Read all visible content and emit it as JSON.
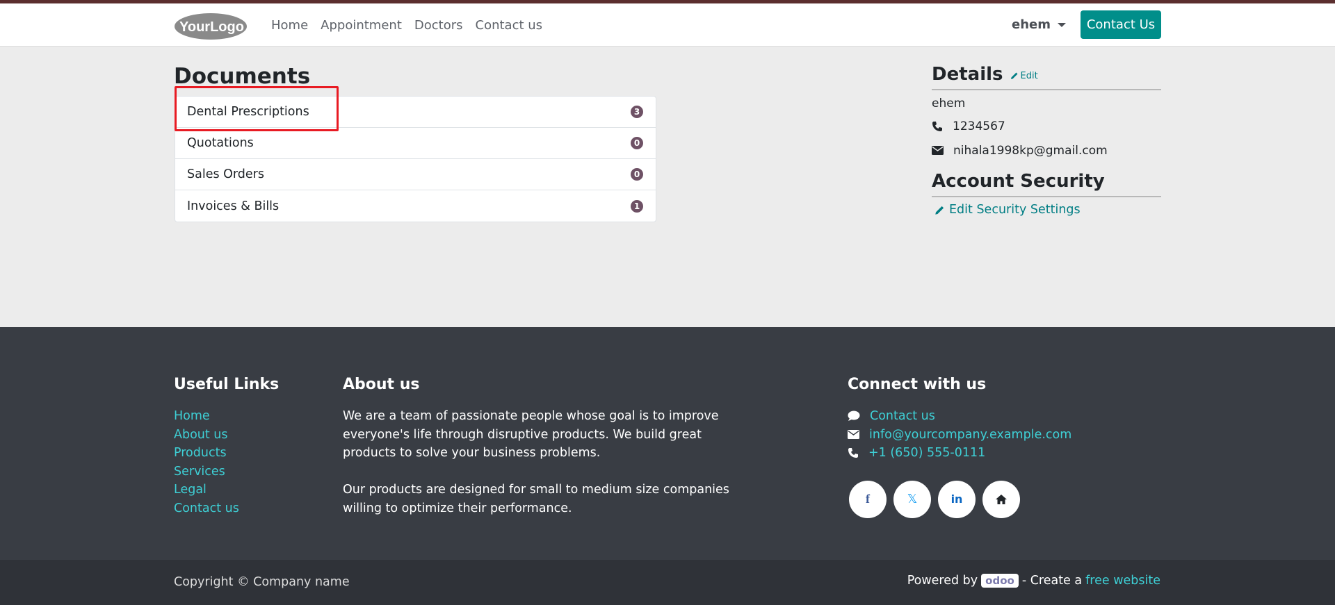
{
  "header": {
    "logo_text": "YourLogo",
    "nav": [
      "Home",
      "Appointment",
      "Doctors",
      "Contact us"
    ],
    "user_name": "ehem",
    "contact_button": "Contact Us"
  },
  "documents": {
    "title": "Documents",
    "items": [
      {
        "label": "Dental Prescriptions",
        "count": "3"
      },
      {
        "label": "Quotations",
        "count": "0"
      },
      {
        "label": "Sales Orders",
        "count": "0"
      },
      {
        "label": "Invoices & Bills",
        "count": "1"
      }
    ]
  },
  "details": {
    "title": "Details",
    "edit_label": "Edit",
    "name": "ehem",
    "phone": "1234567",
    "email": "nihala1998kp@gmail.com",
    "security_title": "Account Security",
    "security_link": "Edit Security Settings"
  },
  "footer": {
    "useful_links_title": "Useful Links",
    "useful_links": [
      "Home",
      "About us",
      "Products",
      "Services",
      "Legal",
      "Contact us"
    ],
    "about_title": "About us",
    "about_p1": "We are a team of passionate people whose goal is to improve everyone's life through disruptive products. We build great products to solve your business problems.",
    "about_p2": "Our products are designed for small to medium size companies willing to optimize their performance.",
    "connect_title": "Connect with us",
    "connect": {
      "contact": "Contact us",
      "email": "info@yourcompany.example.com",
      "phone": "+1 (650) 555-0111"
    },
    "socials": [
      "facebook-icon",
      "x-icon",
      "linkedin-icon",
      "home-icon"
    ]
  },
  "bottombar": {
    "copyright": "Copyright © Company name",
    "powered_by": "Powered by",
    "odoo": "odoo",
    "create_a": "- Create a",
    "free_website": "free website"
  }
}
